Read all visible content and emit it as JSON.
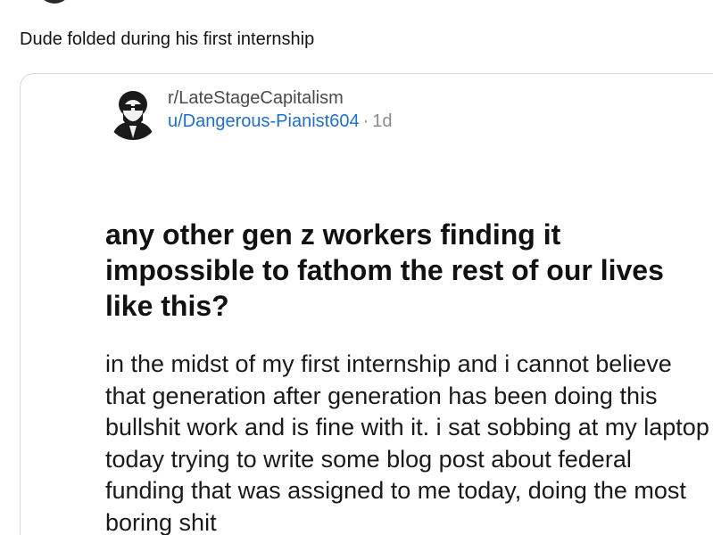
{
  "tweet": {
    "text": "Dude folded during his first internship"
  },
  "quoted_post": {
    "avatar_icon": "bearded-man-glasses-avatar",
    "subreddit": "r/LateStageCapitalism",
    "username": "u/Dangerous-Pianist604",
    "separator": "·",
    "age": "1d",
    "title": "any other gen z workers finding it impossible to fathom the rest of our lives like this?",
    "body": "in the midst of my first internship and i cannot believe that generation after generation has been doing this bullshit work and is fine with it. i sat sobbing at my laptop today trying to write some blog post about federal funding that was assigned to me today, doing the most boring shit"
  },
  "colors": {
    "username_link": "#1d6fd1",
    "card_border": "#cfd9de"
  }
}
